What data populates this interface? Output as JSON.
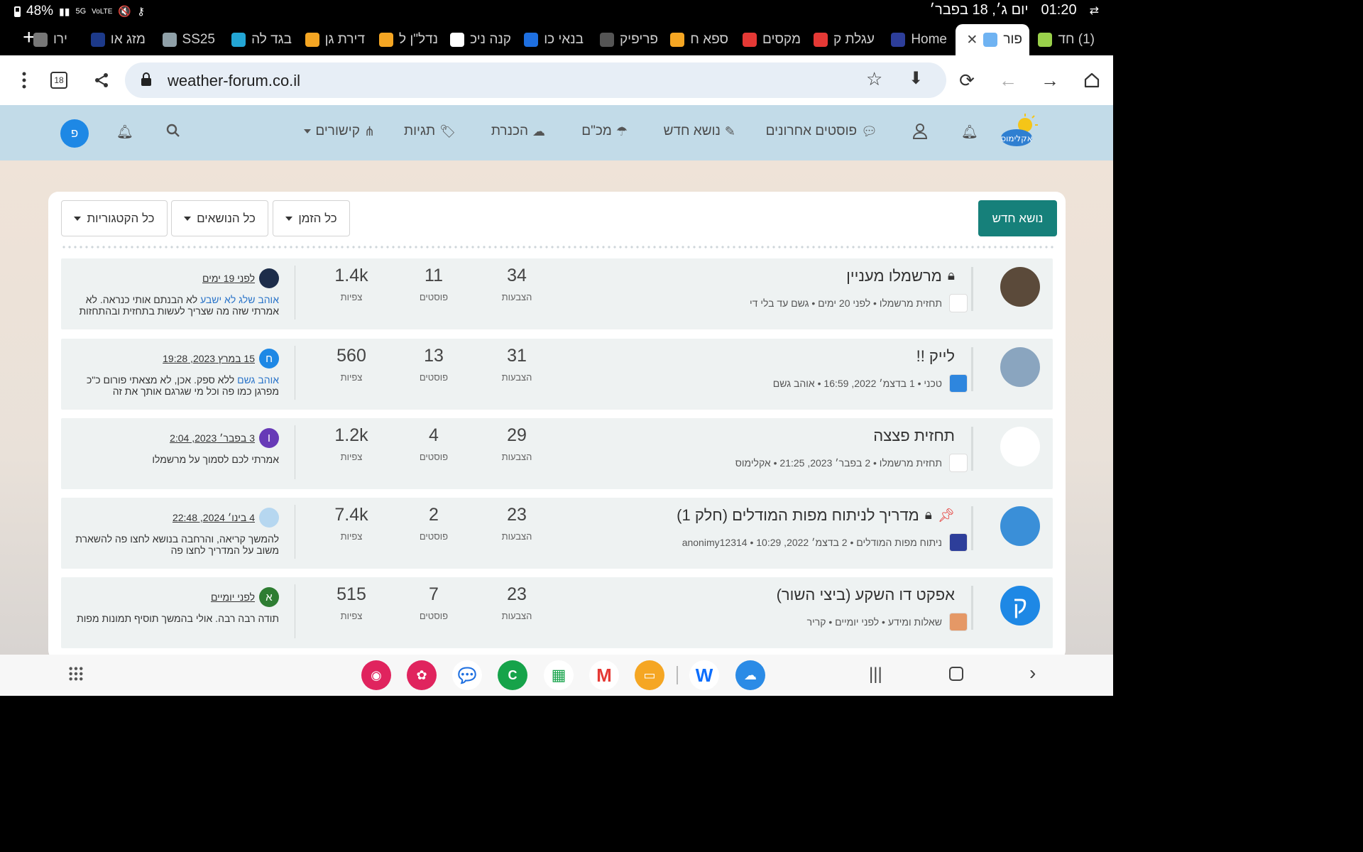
{
  "status_bar": {
    "battery": "48%",
    "time": "01:20",
    "date": "יום ג׳, 18 בפבר׳"
  },
  "tabs": [
    {
      "label": "(1) חד",
      "active": false
    },
    {
      "label": "פור",
      "active": true
    },
    {
      "label": "Home",
      "active": false
    },
    {
      "label": "עגלת ק",
      "active": false
    },
    {
      "label": "מקסים",
      "active": false
    },
    {
      "label": "ספא ח",
      "active": false
    },
    {
      "label": "פריפיק",
      "active": false
    },
    {
      "label": "בנאי כו",
      "active": false
    },
    {
      "label": "קנה ניכ",
      "active": false
    },
    {
      "label": "נדל\"ן ל",
      "active": false
    },
    {
      "label": "דירת גן",
      "active": false
    },
    {
      "label": "בגד לה",
      "active": false
    },
    {
      "label": "SS25",
      "active": false
    },
    {
      "label": "מזג או",
      "active": false
    },
    {
      "label": "ירו",
      "active": false
    }
  ],
  "address_bar": {
    "url": "weather-forum.co.il",
    "tab_count": "18"
  },
  "nav": {
    "recent_posts": "פוסטים אחרונים",
    "new_topic": "נושא חדש",
    "mechas": "מכ\"ם",
    "kinneret": "הכנרת",
    "tags": "תגיות",
    "links": "קישורים",
    "user_initial": "פ"
  },
  "toolbar": {
    "new_topic_button": "נושא חדש",
    "filter_time": "כל הזמן",
    "filter_topics": "כל הנושאים",
    "filter_categories": "כל הקטגוריות"
  },
  "labels": {
    "votes": "הצבעות",
    "posts": "פוסטים",
    "views": "צפיות"
  },
  "topics": [
    {
      "title": "מרשמלו מעניין",
      "locked": true,
      "pinned": false,
      "meta": "תחזית מרשמלו • לפני 20 ימים • גשם עד בלי די",
      "votes": "34",
      "posts": "11",
      "views": "1.4k",
      "last_time": "לפני 19 ימים",
      "last_user_initial": "",
      "last_user": "אוהב שלג לא ישבע",
      "last_text": " לא הבנתם אותי כנראה. לא אמרתי שזה מה שצריך לעשות בתחזית ובהתחזות",
      "avatar_color": "#5b4a3a",
      "last_color": "#1d2d4a",
      "cat_color": "#ffffff"
    },
    {
      "title": "לייק !!",
      "locked": false,
      "pinned": false,
      "meta": "טכני • 1 בדצמ׳ 2022, 16:59 • אוהב גשם",
      "votes": "31",
      "posts": "13",
      "views": "560",
      "last_time": "15 במרץ 2023, 19:28",
      "last_user_initial": "ח",
      "last_user": "אוהב גשם",
      "last_text": " ללא ספק. אכן, לא מצאתי פורום כ\"כ מפרגן כמו פה וכל מי שגרגם אותך את זה",
      "avatar_color": "#8aa5bf",
      "last_color": "#1e88e5",
      "cat_color": "#2e86de"
    },
    {
      "title": "תחזית פצצה",
      "locked": false,
      "pinned": false,
      "meta": "תחזית מרשמלו • 2 בפבר׳ 2023, 21:25 • אקלימוס",
      "votes": "29",
      "posts": "4",
      "views": "1.2k",
      "last_time": "3 בפבר׳ 2023, 2:04",
      "last_user_initial": "I",
      "last_user": "",
      "last_text": "אמרתי לכם לסמוך על מרשמלו",
      "avatar_color": "#ffffff",
      "last_color": "#673ab7",
      "cat_color": "#ffffff"
    },
    {
      "title": "מדריך לניתוח מפות המודלים (חלק 1)",
      "locked": true,
      "pinned": true,
      "meta": "ניתוח מפות המודלים • 2 בדצמ׳ 2022, 10:29 • anonimy12314",
      "votes": "23",
      "posts": "2",
      "views": "7.4k",
      "last_time": "4 בינו׳ 2024, 22:48",
      "last_user_initial": "",
      "last_user": "",
      "last_text": "להמשך קריאה, והרחבה בנושא לחצו פה להשארת משוב על המדריך לחצו פה",
      "avatar_color": "#3a8fd8",
      "last_color": "#b6d7f0",
      "cat_color": "#2d3e9a"
    },
    {
      "title": "אפקט דו השקע (ביצי השור)",
      "locked": false,
      "pinned": false,
      "meta": "שאלות ומידע • לפני יומיים • קריר",
      "votes": "23",
      "posts": "7",
      "views": "515",
      "last_time": "לפני יומיים",
      "last_user_initial": "א",
      "last_user": "",
      "last_text": "תודה רבה רבה. אולי בהמשך תוסיף תמונות מפות",
      "avatar_color": "#1e88e5",
      "last_color": "#2e7d32",
      "cat_color": "#e59866",
      "avatar_letter": "ק"
    }
  ]
}
